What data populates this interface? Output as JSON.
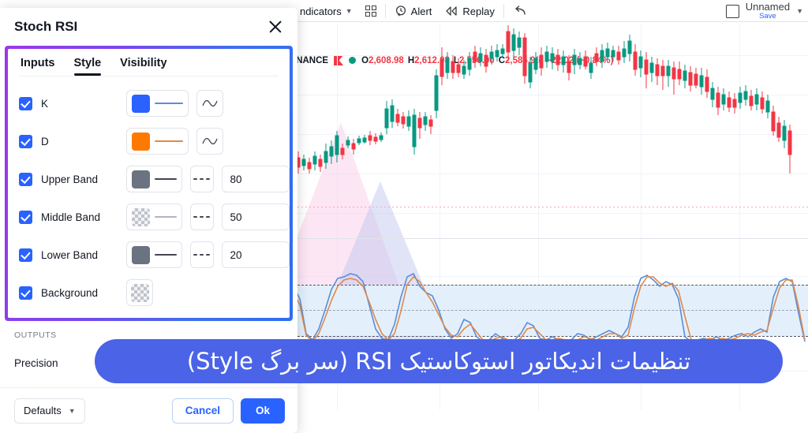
{
  "toolbar": {
    "indicators_label": "ndicators",
    "layout_icon": "grid-layout-icon",
    "alert_label": "Alert",
    "replay_label": "Replay",
    "undo_icon": "undo-arrow-icon",
    "unnamed_label": "Unnamed",
    "save_label": "Save"
  },
  "chart": {
    "symbol": "INANCE",
    "ohlc": [
      {
        "label": "O",
        "value": "2,608.98"
      },
      {
        "label": "H",
        "value": "2,612.08"
      },
      {
        "label": "L",
        "value": "2,556.00"
      },
      {
        "label": "C",
        "value": "2,586.96"
      }
    ],
    "change": "−22.02 (−0.84%)",
    "up_color": "#089981",
    "down_color": "#f23645",
    "k_line_color": "#5b8ddb",
    "d_line_color": "#e08a4a",
    "band_fill_color": "#e3f0fb"
  },
  "dialog": {
    "title": "Stoch RSI",
    "close_icon": "close-icon",
    "tabs": [
      {
        "label": "Inputs",
        "active": false
      },
      {
        "label": "Style",
        "active": true
      },
      {
        "label": "Visibility",
        "active": false
      }
    ],
    "rows": [
      {
        "label": "K",
        "checked": true,
        "color": "#2962ff",
        "line_color": "#5b8ddb",
        "has_style_wave": true,
        "has_dash": false,
        "value": null,
        "transparent": false
      },
      {
        "label": "D",
        "checked": true,
        "color": "#ff7800",
        "line_color": "#e08a4a",
        "has_style_wave": true,
        "has_dash": false,
        "value": null,
        "transparent": false
      },
      {
        "label": "Upper Band",
        "checked": true,
        "color": "#6b7280",
        "line_color": "#434651",
        "has_style_wave": false,
        "has_dash": true,
        "value": "80",
        "transparent": false
      },
      {
        "label": "Middle Band",
        "checked": true,
        "color": "",
        "line_color": "#b2b5be",
        "has_style_wave": false,
        "has_dash": true,
        "value": "50",
        "transparent": true
      },
      {
        "label": "Lower Band",
        "checked": true,
        "color": "#6b7280",
        "line_color": "#434651",
        "has_style_wave": false,
        "has_dash": true,
        "value": "20",
        "transparent": false
      },
      {
        "label": "Background",
        "checked": true,
        "color": "",
        "line_color": "",
        "has_style_wave": false,
        "has_dash": false,
        "value": null,
        "transparent": true,
        "color_only": true
      }
    ],
    "outputs_title": "OUTPUTS",
    "precision_label": "Precision",
    "defaults_label": "Defaults",
    "cancel_label": "Cancel",
    "ok_label": "Ok",
    "accent_color": "#2962ff",
    "highlight_gradient_from": "#9b38e8",
    "highlight_gradient_to": "#2f6df2"
  },
  "caption": {
    "text": "تنظیمات اندیکاتور استوکاستیک RSI (سر برگ Style)",
    "background_color": "#4a63e7"
  }
}
